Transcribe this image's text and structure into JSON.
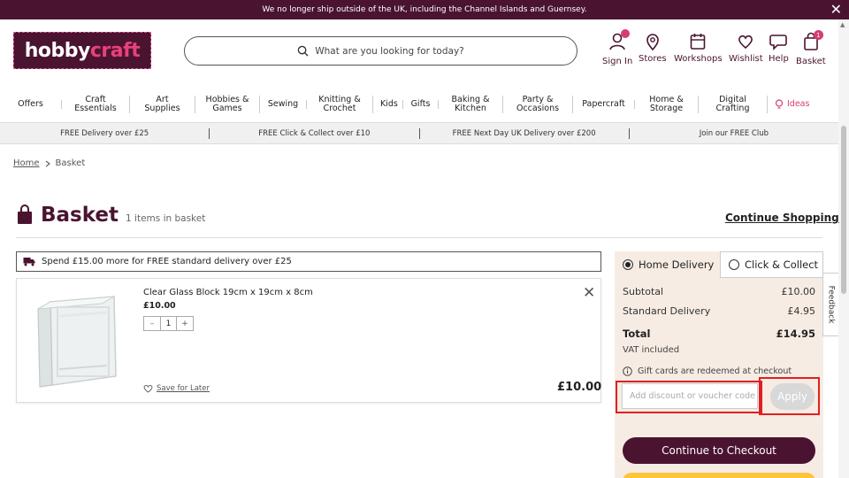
{
  "announcement": {
    "text": "We no longer ship outside of the UK, including the Channel Islands and Guernsey."
  },
  "logo": {
    "text_a": "hobby",
    "text_b": "craft"
  },
  "search": {
    "placeholder": "What are you looking for today?"
  },
  "header_icons": [
    {
      "label": "Sign In",
      "icon": "user-icon"
    },
    {
      "label": "Stores",
      "icon": "location-pin-icon"
    },
    {
      "label": "Workshops",
      "icon": "calendar-icon"
    },
    {
      "label": "Wishlist",
      "icon": "heart-icon"
    },
    {
      "label": "Help",
      "icon": "chat-bubble-icon"
    },
    {
      "label": "Basket",
      "icon": "basket-bag-icon",
      "badge": "1"
    }
  ],
  "nav": {
    "items": [
      "Offers",
      "Craft Essentials",
      "Art Supplies",
      "Hobbies & Games",
      "Sewing",
      "Knitting & Crochet",
      "Kids",
      "Gifts",
      "Baking & Kitchen",
      "Party & Occasions",
      "Papercraft",
      "Home & Storage",
      "Digital Crafting"
    ],
    "ideas": "Ideas"
  },
  "promo": [
    "FREE Delivery over £25",
    "FREE Click & Collect over £10",
    "FREE Next Day UK Delivery over £200",
    "Join our FREE Club"
  ],
  "breadcrumb": {
    "home": "Home",
    "current": "Basket"
  },
  "basket": {
    "title": "Basket",
    "count": "1 items in basket",
    "continue": "Continue Shopping",
    "notice": "Spend £15.00 more for FREE standard delivery over £25"
  },
  "item": {
    "name": "Clear Glass Block 19cm x 19cm x 8cm",
    "price": "£10.00",
    "qty": "1",
    "minus": "–",
    "plus": "+",
    "save": "Save for Later",
    "total": "£10.00"
  },
  "summary": {
    "tab_home": "Home Delivery",
    "tab_cc": "Click & Collect",
    "subtotal_label": "Subtotal",
    "subtotal": "£10.00",
    "delivery_label": "Standard Delivery",
    "delivery": "£4.95",
    "total_label": "Total",
    "total": "£14.95",
    "vat": "VAT included",
    "gift": "Gift cards are redeemed at checkout",
    "voucher_placeholder": "Add discount or voucher code",
    "apply": "Apply",
    "checkout": "Continue to Checkout"
  },
  "feedback": "Feedback",
  "colors": {
    "brand": "#4a1430",
    "accent": "#d63c72",
    "panel": "#f6ece4",
    "highlight": "#e02020"
  }
}
